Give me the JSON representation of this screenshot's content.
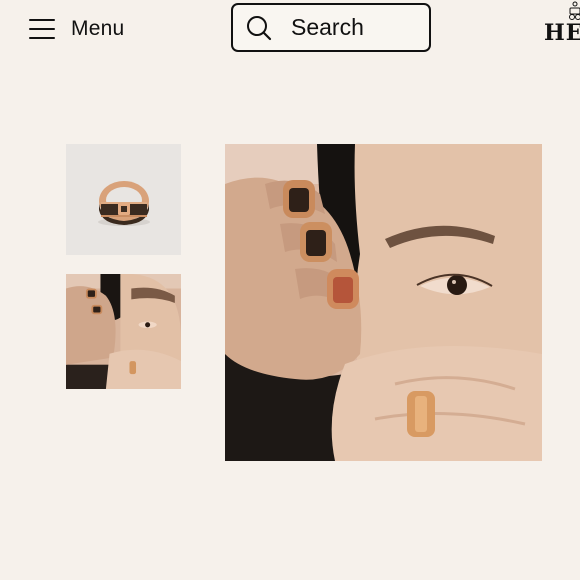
{
  "header": {
    "menu_label": "Menu",
    "search_label": "Search",
    "brand_text": "HE"
  },
  "icons": {
    "menu": "hamburger-icon",
    "search": "search-icon",
    "brand": "carriage-logo-icon"
  },
  "gallery": {
    "thumbnails": [
      {
        "subject": "ring-product-shot"
      },
      {
        "subject": "model-wearing-rings"
      }
    ],
    "main_image": {
      "subject": "model-wearing-rings"
    }
  },
  "colors": {
    "background": "#f6f1eb",
    "text": "#111111",
    "ring_gold": "#d79a64",
    "ring_enamel": "#3a2a1e"
  }
}
